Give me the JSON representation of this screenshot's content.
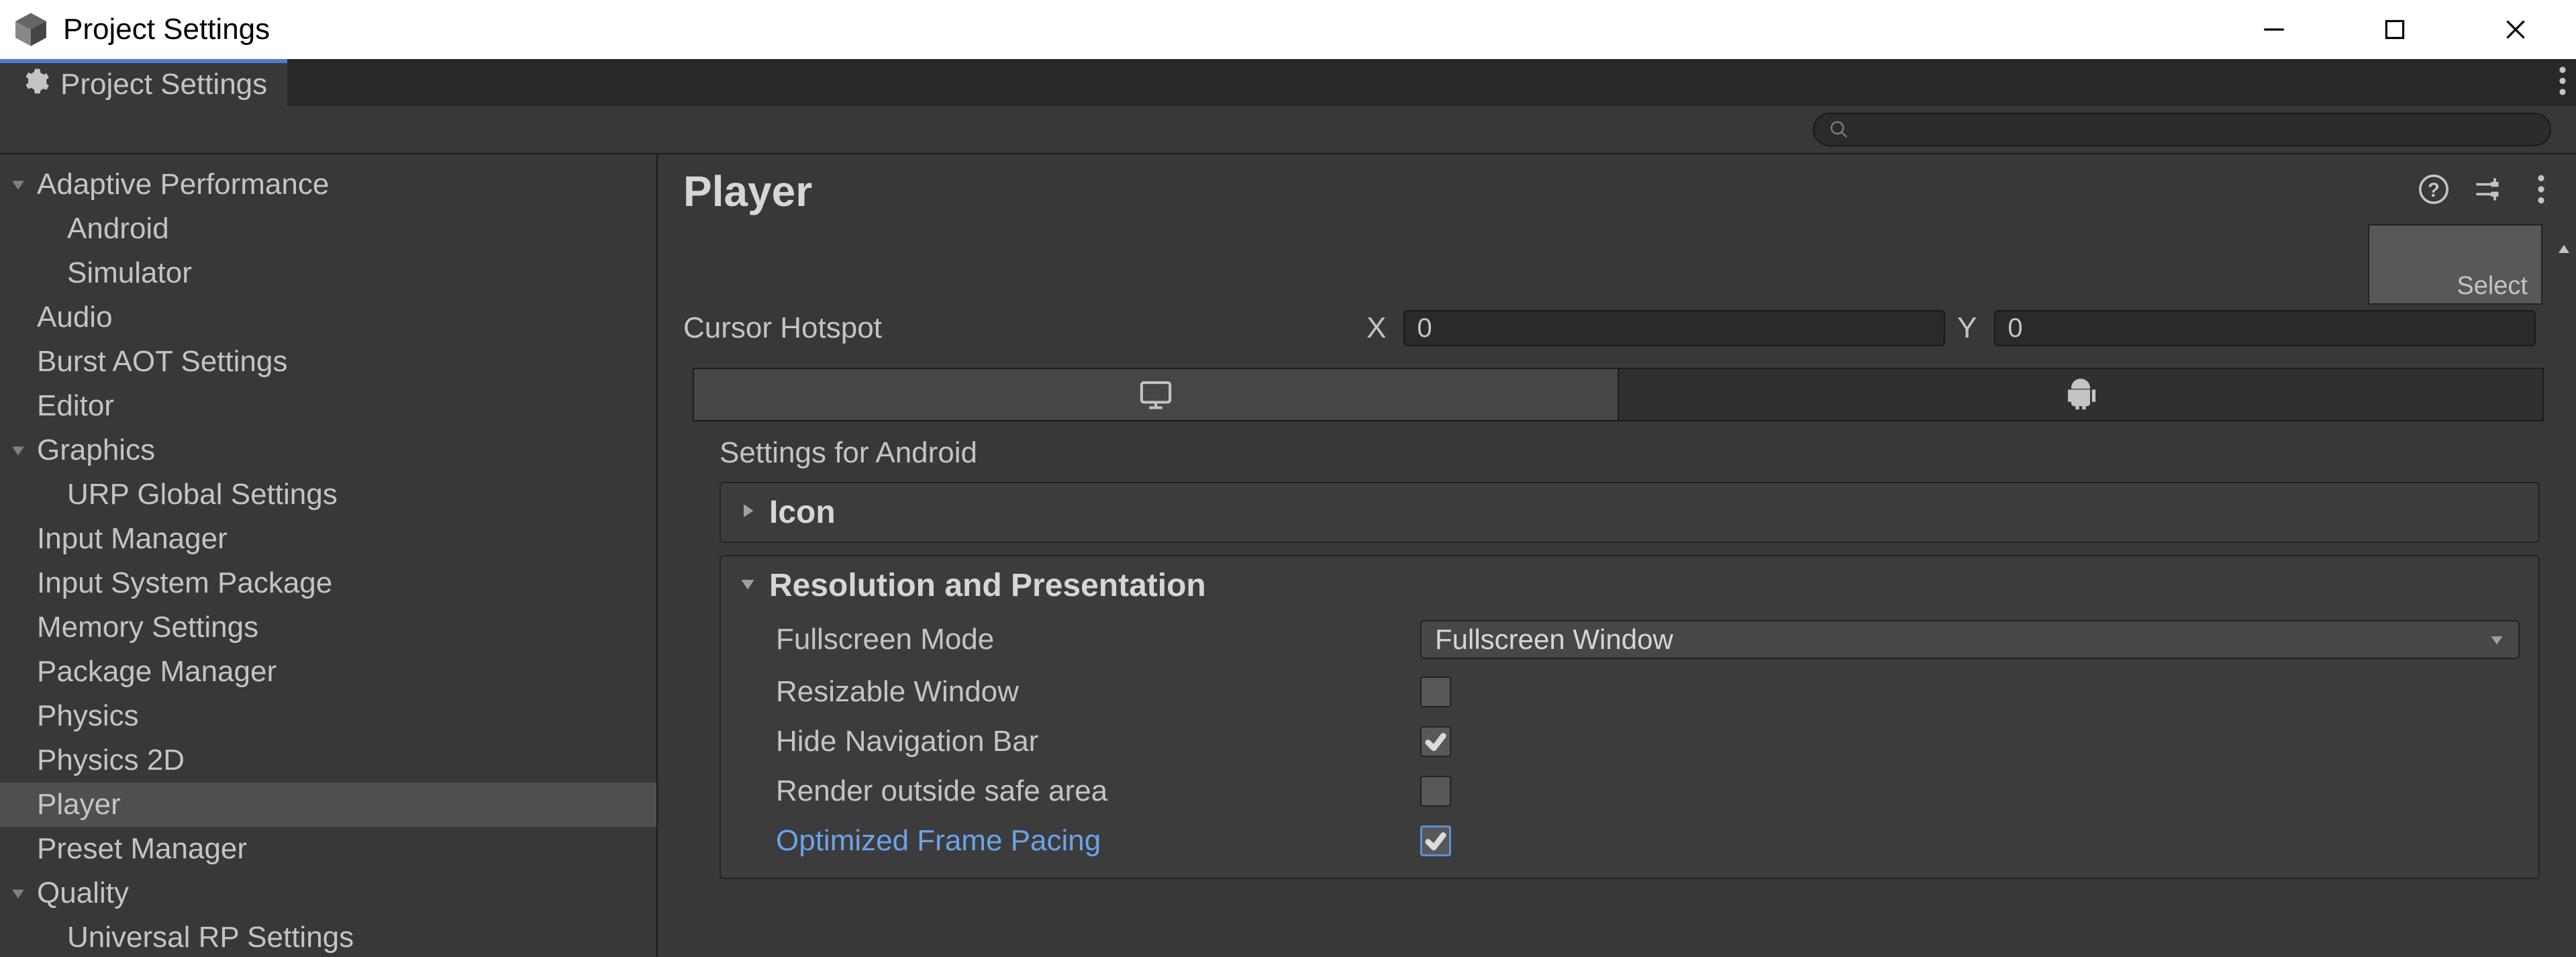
{
  "window": {
    "title": "Project Settings"
  },
  "tab": {
    "label": "Project Settings"
  },
  "search": {
    "placeholder": ""
  },
  "sidebar": {
    "items": [
      {
        "label": "Adaptive Performance",
        "caret": true
      },
      {
        "label": "Android",
        "child": true
      },
      {
        "label": "Simulator",
        "child": true
      },
      {
        "label": "Audio"
      },
      {
        "label": "Burst AOT Settings"
      },
      {
        "label": "Editor"
      },
      {
        "label": "Graphics",
        "caret": true
      },
      {
        "label": "URP Global Settings",
        "child": true
      },
      {
        "label": "Input Manager"
      },
      {
        "label": "Input System Package"
      },
      {
        "label": "Memory Settings"
      },
      {
        "label": "Package Manager"
      },
      {
        "label": "Physics"
      },
      {
        "label": "Physics 2D"
      },
      {
        "label": "Player",
        "selected": true
      },
      {
        "label": "Preset Manager"
      },
      {
        "label": "Quality",
        "caret": true
      },
      {
        "label": "Universal RP Settings",
        "child": true
      }
    ]
  },
  "main": {
    "title": "Player",
    "select_label": "Select",
    "cursor_hotspot": {
      "label": "Cursor Hotspot",
      "x_label": "X",
      "x_value": "0",
      "y_label": "Y",
      "y_value": "0"
    },
    "settings_for": "Settings for Android",
    "foldouts": {
      "icon": {
        "title": "Icon"
      },
      "resolution": {
        "title": "Resolution and Presentation",
        "fullscreen_mode": {
          "label": "Fullscreen Mode",
          "value": "Fullscreen Window"
        },
        "resizable_window": {
          "label": "Resizable Window",
          "checked": false
        },
        "hide_nav_bar": {
          "label": "Hide Navigation Bar",
          "checked": true
        },
        "render_outside_safe": {
          "label": "Render outside safe area",
          "checked": false
        },
        "optimized_frame_pacing": {
          "label": "Optimized Frame Pacing",
          "checked": true
        }
      }
    }
  }
}
